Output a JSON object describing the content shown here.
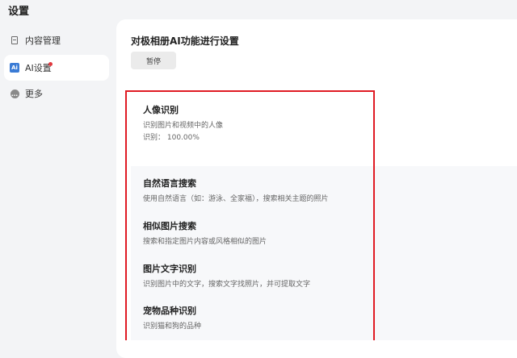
{
  "page": {
    "title": "设置"
  },
  "sidebar": {
    "items": [
      {
        "label": "内容管理",
        "icon": "file-icon"
      },
      {
        "label": "AI设置",
        "icon": "ai-icon",
        "badge": "red-dot"
      },
      {
        "label": "更多",
        "icon": "more-icon"
      }
    ]
  },
  "main": {
    "heading": "对极相册AI功能进行设置",
    "pause_label": "暂停",
    "features": [
      {
        "title": "人像识别",
        "desc": "识别图片和视频中的人像",
        "extra": "识别： 100.00%"
      },
      {
        "title": "自然语言搜索",
        "desc": "使用自然语言（如：游泳、全家福），搜索相关主题的照片"
      },
      {
        "title": "相似图片搜索",
        "desc": "搜索和指定图片内容或风格相似的图片"
      },
      {
        "title": "图片文字识别",
        "desc": "识别图片中的文字，搜索文字找照片，并可提取文字"
      },
      {
        "title": "宠物品种识别",
        "desc": "识别猫和狗的品种"
      }
    ]
  },
  "colors": {
    "highlight_border": "#e01b24",
    "ai_icon": "#3a7bd5",
    "badge": "#e0383e"
  }
}
